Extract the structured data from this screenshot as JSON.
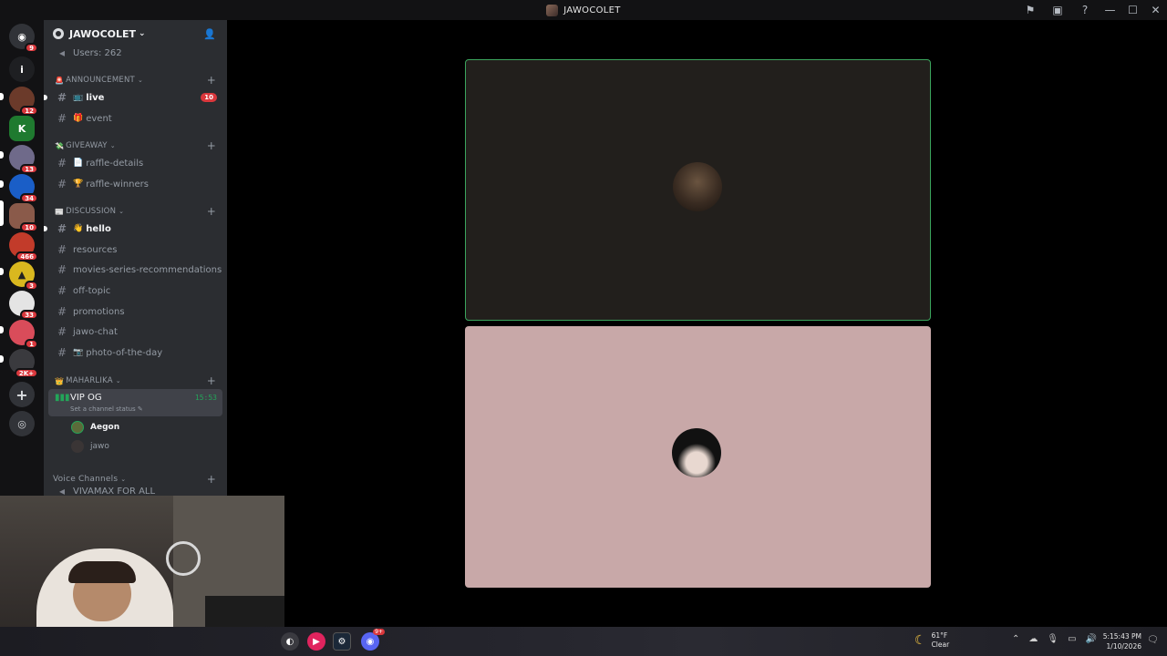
{
  "window": {
    "title": "JAWOCOLET",
    "icons": [
      "flag-icon",
      "inbox-icon",
      "help-icon"
    ],
    "controls": [
      "minimize-icon",
      "maximize-icon",
      "close-icon"
    ]
  },
  "rail": {
    "servers": [
      {
        "name": "discord-home",
        "badge": "9"
      },
      {
        "name": "server-info",
        "glyph": "i"
      },
      {
        "name": "server-1",
        "badge": "12"
      },
      {
        "name": "server-2",
        "badge": ""
      },
      {
        "name": "server-3",
        "badge": "13"
      },
      {
        "name": "server-4",
        "badge": "34"
      },
      {
        "name": "server-5",
        "badge": "10"
      },
      {
        "name": "server-6",
        "badge": "466"
      },
      {
        "name": "server-7",
        "badge": "3"
      },
      {
        "name": "server-8",
        "badge": "33"
      },
      {
        "name": "server-9",
        "badge": "1"
      },
      {
        "name": "server-10",
        "badge": "2K+"
      }
    ]
  },
  "sidebar": {
    "server_name": "JAWOCOLET",
    "server_chevron": "⌄",
    "users_label": "Users: 262",
    "categories": {
      "announcement": "ANNOUNCEMENT",
      "giveaway": "GIVEAWAY",
      "discussion": "DISCUSSION",
      "maharlika": "MAHARLIKA",
      "voice": "Voice Channels"
    },
    "channels": {
      "live": {
        "label": "live",
        "emoji": "📺",
        "badge": "10"
      },
      "event": {
        "label": "event",
        "emoji": "🎁"
      },
      "raffle_details": {
        "label": "raffle-details",
        "emoji": "📄"
      },
      "raffle_winners": {
        "label": "raffle-winners",
        "emoji": "🏆"
      },
      "hello": {
        "label": "hello",
        "emoji": "👋"
      },
      "resources": {
        "label": "resources"
      },
      "movies": {
        "label": "movies-series-recommendations"
      },
      "off_topic": {
        "label": "off-topic"
      },
      "promotions": {
        "label": "promotions"
      },
      "jawo_chat": {
        "label": "jawo-chat"
      },
      "photo": {
        "label": "photo-of-the-day",
        "emoji": "📷"
      }
    },
    "voice_channel": {
      "name": "VIP OG",
      "time": "15:53",
      "status": "Set a channel status"
    },
    "voice_users": [
      "Aegon",
      "jawo"
    ],
    "next_voice": "VIVAMAX FOR ALL"
  },
  "taskbar": {
    "weather_temp": "61°F",
    "weather_desc": "Clear",
    "time": "5:15:43 PM",
    "date": "1/10/2026",
    "discord_badge": "9+"
  },
  "colors": {
    "speaking_border": "#3ba55d",
    "badge_red": "#da373c",
    "tile1_bg": "#221f1c",
    "tile2_bg": "#c8a8a8"
  }
}
